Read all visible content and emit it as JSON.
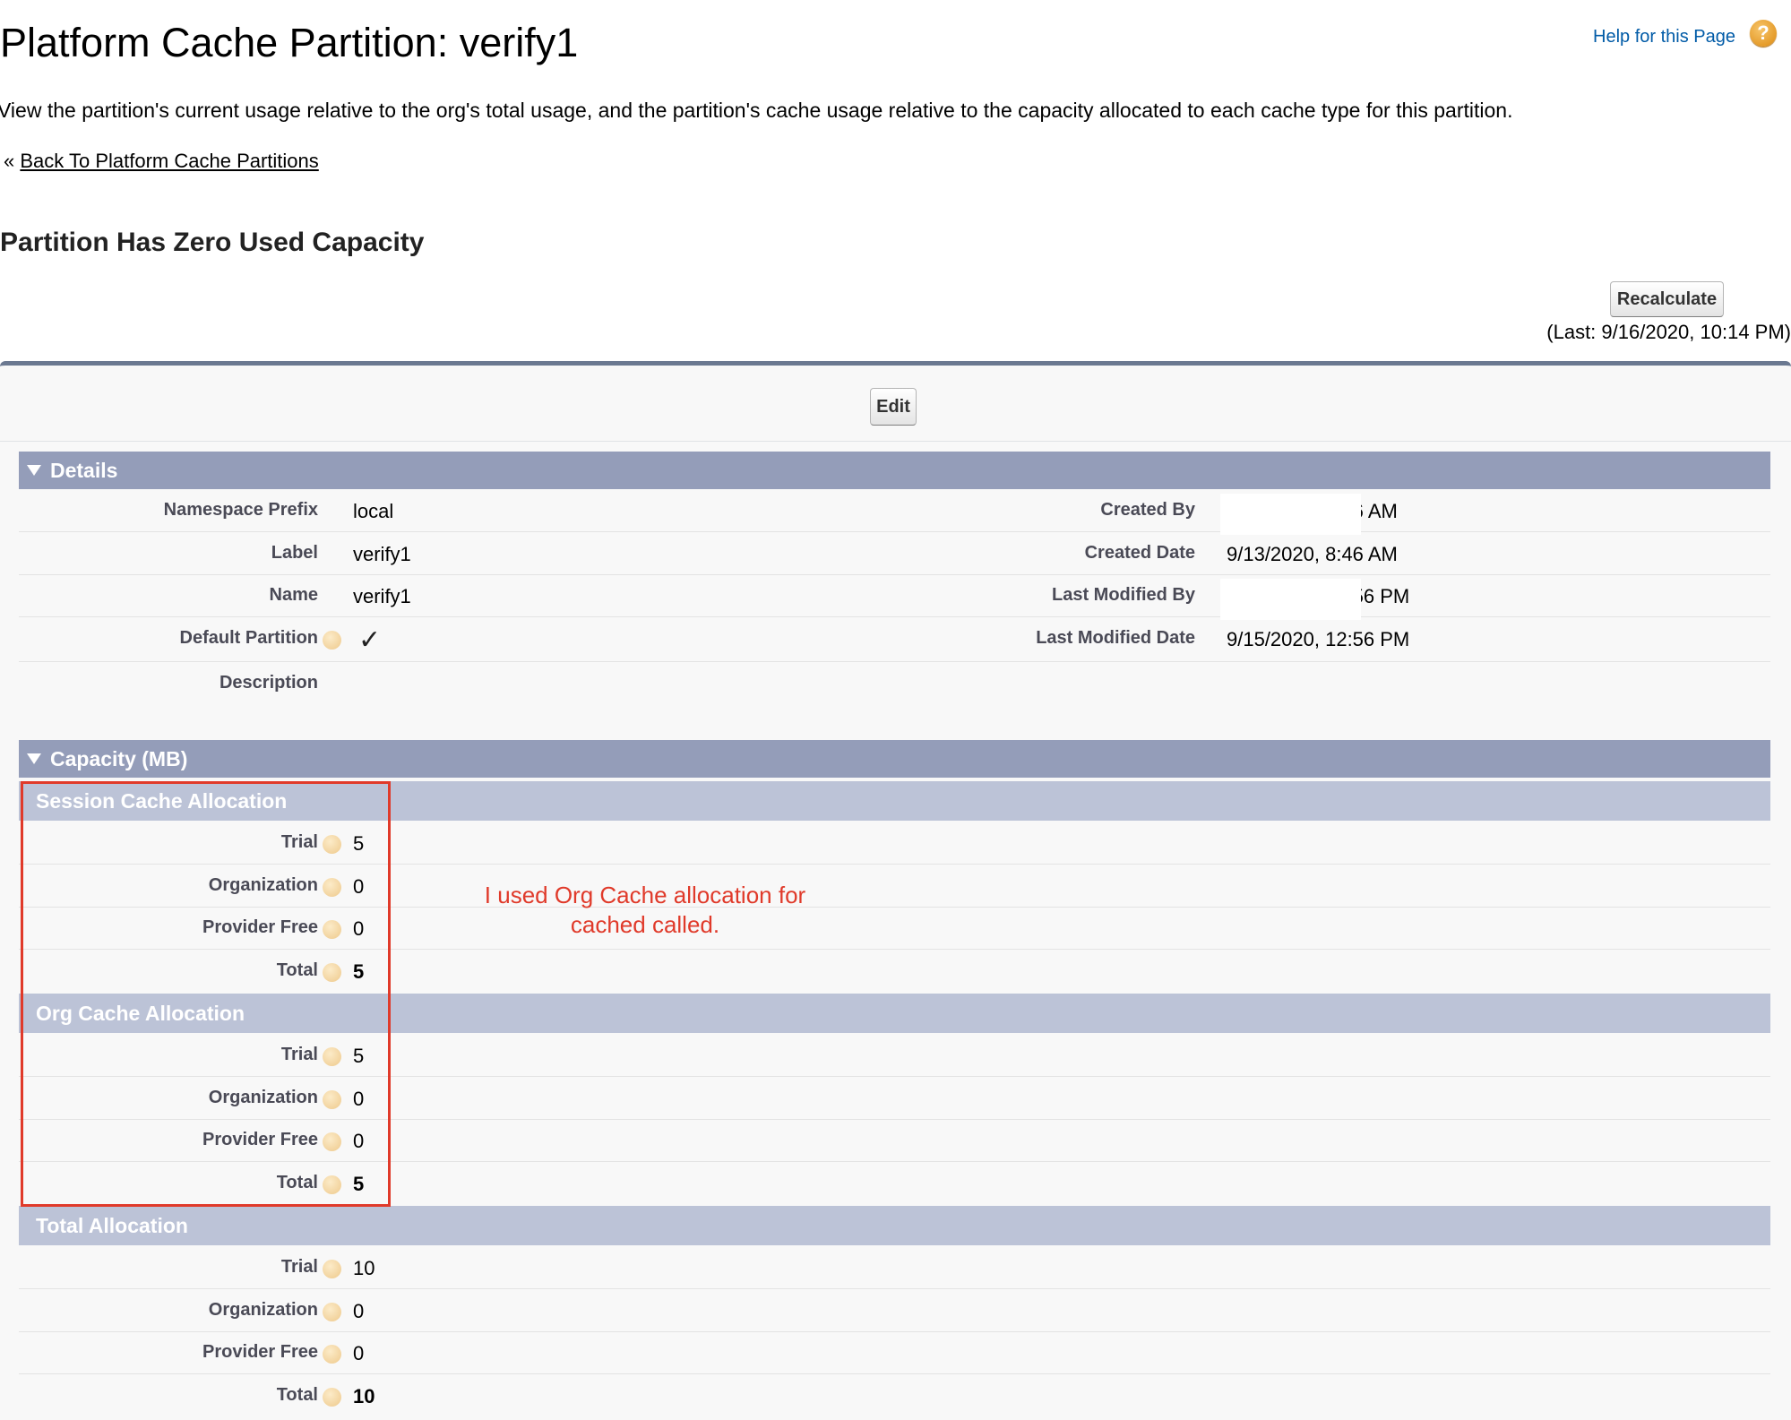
{
  "page": {
    "title": "Platform Cache Partition: verify1",
    "help_link": "Help for this Page",
    "description": "View the partition's current usage relative to the org's total usage, and the partition's cache usage relative to the capacity allocated to each cache type for this partition.",
    "back_prefix": "«",
    "back_link": "Back To Platform Cache Partitions",
    "section_heading": "Partition Has Zero Used Capacity",
    "recalculate_label": "Recalculate",
    "last_calculated": "(Last: 9/16/2020, 10:14 PM)",
    "edit_label": "Edit"
  },
  "details": {
    "title": "Details",
    "namespace_prefix": {
      "label": "Namespace Prefix",
      "value": "local"
    },
    "label": {
      "label": "Label",
      "value": "verify1"
    },
    "name": {
      "label": "Name",
      "value": "verify1"
    },
    "default_partition": {
      "label": "Default Partition",
      "checked": true,
      "check_glyph": "✓"
    },
    "description": {
      "label": "Description",
      "value": ""
    },
    "created_by": {
      "label": "Created By",
      "value": "9/13/2020, 8:46 AM"
    },
    "created_date": {
      "label": "Created Date",
      "value": "9/13/2020, 8:46 AM"
    },
    "last_modified_by": {
      "label": "Last Modified By",
      "value": "9/15/2020, 12:56 PM"
    },
    "last_modified_date": {
      "label": "Last Modified Date",
      "value": "9/15/2020, 12:56 PM"
    }
  },
  "capacity": {
    "title": "Capacity (MB)",
    "session": {
      "title": "Session Cache Allocation",
      "trial_label": "Trial",
      "trial": "5",
      "org_label": "Organization",
      "org": "0",
      "provider_label": "Provider Free",
      "provider": "0",
      "total_label": "Total",
      "total": "5"
    },
    "org": {
      "title": "Org Cache Allocation",
      "trial_label": "Trial",
      "trial": "5",
      "org_label": "Organization",
      "org": "0",
      "provider_label": "Provider Free",
      "provider": "0",
      "total_label": "Total",
      "total": "5"
    },
    "total": {
      "title": "Total Allocation",
      "trial_label": "Trial",
      "trial": "10",
      "org_label": "Organization",
      "org": "0",
      "provider_label": "Provider Free",
      "provider": "0",
      "total_label": "Total",
      "total": "10"
    }
  },
  "annotation": {
    "line1": "I used Org Cache allocation for",
    "line2": "cached called.",
    "color": "#e03a2a"
  },
  "icons": {
    "help": "?",
    "help_icon": "help-question-icon",
    "section_toggle": "triangle-down-icon",
    "info": "info-help-icon"
  }
}
